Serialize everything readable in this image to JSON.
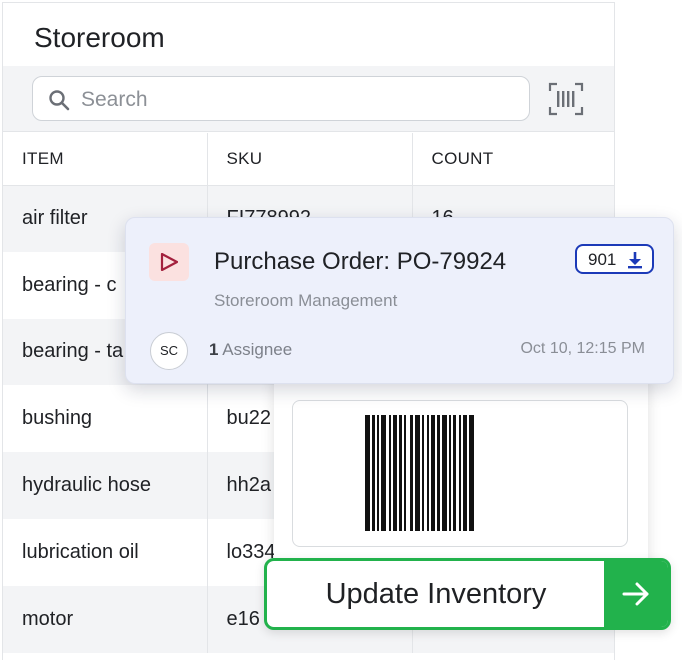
{
  "storeroom": {
    "title": "Storeroom",
    "search": {
      "placeholder": "Search",
      "value": ""
    },
    "scan_icon": "barcode-scan-icon",
    "columns": [
      "ITEM",
      "SKU",
      "COUNT"
    ],
    "rows": [
      {
        "item": "air filter",
        "sku": "FI778992",
        "count": "16"
      },
      {
        "item": "bearing - c",
        "sku": "",
        "count": ""
      },
      {
        "item": "bearing - ta",
        "sku": "",
        "count": ""
      },
      {
        "item": "bushing",
        "sku": "bu22",
        "count": ""
      },
      {
        "item": "hydraulic hose",
        "sku": "hh2a",
        "count": ""
      },
      {
        "item": "lubrication oil",
        "sku": "lo334",
        "count": ""
      },
      {
        "item": "motor",
        "sku": "e16",
        "count": ""
      }
    ]
  },
  "purchase_order": {
    "icon": "play-triangle-icon",
    "title": "Purchase Order: PO-79924",
    "badge_count": "901",
    "badge_icon": "download-icon",
    "subtitle": "Storeroom Management",
    "assignee_initials": "SC",
    "assignee_count": "1",
    "assignee_label": "Assignee",
    "date": "Oct 10, 12:15 PM",
    "accent_color": "#1c3ab8",
    "icon_color": "#a3203d"
  },
  "barcode_card": {
    "icon": "barcode-icon"
  },
  "update_button": {
    "label": "Update Inventory",
    "icon": "arrow-right-icon",
    "color": "#22b24c"
  }
}
